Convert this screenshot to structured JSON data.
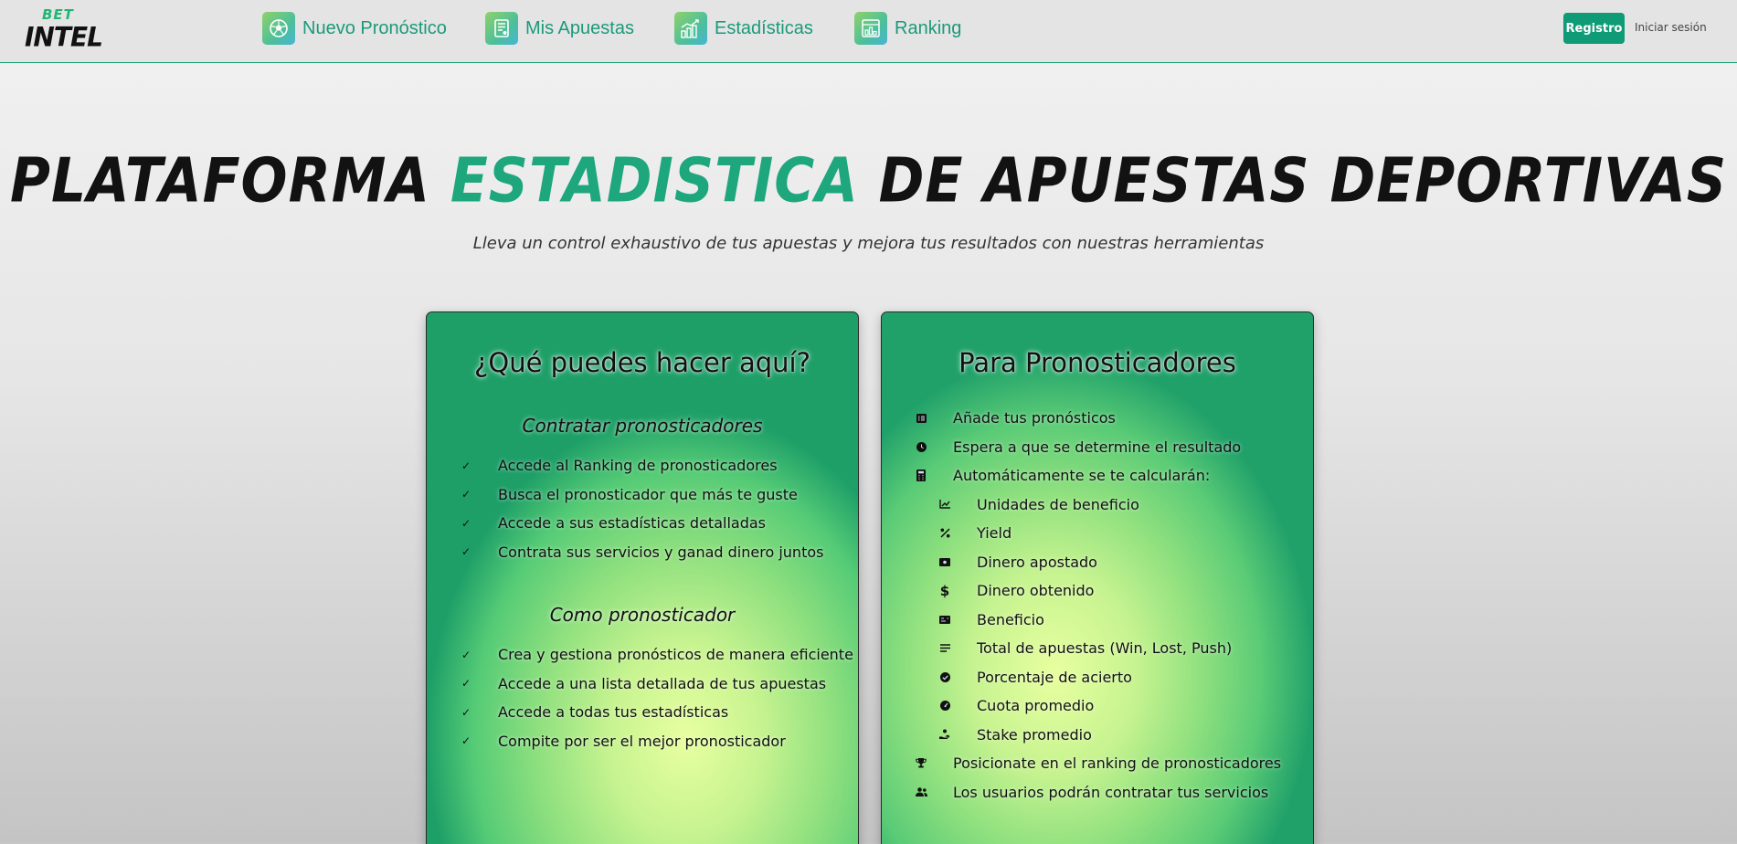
{
  "logo": {
    "line1": "BET",
    "line2": "INTEL"
  },
  "nav": [
    {
      "label": "Nuevo Pronóstico",
      "icon": "soccer-ball-icon"
    },
    {
      "label": "Mis Apuestas",
      "icon": "bet-slip-icon"
    },
    {
      "label": "Estadísticas",
      "icon": "bar-chart-icon"
    },
    {
      "label": "Ranking",
      "icon": "ranking-icon"
    }
  ],
  "auth": {
    "register": "Registro",
    "login": "Iniciar sesión"
  },
  "hero": {
    "title_part1": "PLATAFORMA ",
    "title_accent": "ESTADISTICA",
    "title_part2": " DE APUESTAS DEPORTIVAS",
    "subtitle": "Lleva un control exhaustivo de tus apuestas y mejora tus resultados con nuestras herramientas"
  },
  "left_card": {
    "title": "¿Qué puedes hacer aquí?",
    "section1": {
      "title": "Contratar pronosticadores",
      "items": [
        "Accede al Ranking de pronosticadores",
        "Busca el pronosticador que más te guste",
        "Accede a sus estadísticas detalladas",
        "Contrata sus servicios y ganad dinero juntos"
      ]
    },
    "section2": {
      "title": "Como pronosticador",
      "items": [
        "Crea y gestiona pronósticos de manera eficiente",
        "Accede a una lista detallada de tus apuestas",
        "Accede a todas tus estadísticas",
        "Compite por ser el mejor pronosticador"
      ]
    }
  },
  "right_card": {
    "title": "Para Pronosticadores",
    "items": [
      {
        "text": "Añade tus pronósticos",
        "icon": "list-icon"
      },
      {
        "text": "Espera a que se determine el resultado",
        "icon": "clock-icon"
      },
      {
        "text": "Automáticamente se te calcularán:",
        "icon": "calculator-icon"
      },
      {
        "text": "Unidades de beneficio",
        "icon": "line-chart-icon",
        "sub": true
      },
      {
        "text": "Yield",
        "icon": "percent-icon",
        "sub": true
      },
      {
        "text": "Dinero apostado",
        "icon": "money-bill-icon",
        "sub": true
      },
      {
        "text": "Dinero obtenido",
        "icon": "dollar-icon",
        "sub": true
      },
      {
        "text": "Beneficio",
        "icon": "money-check-icon",
        "sub": true
      },
      {
        "text": "Total de apuestas (Win, Lost, Push)",
        "icon": "bars-icon",
        "sub": true
      },
      {
        "text": "Porcentaje de acierto",
        "icon": "check-circle-icon",
        "sub": true
      },
      {
        "text": "Cuota promedio",
        "icon": "gauge-icon",
        "sub": true
      },
      {
        "text": "Stake promedio",
        "icon": "hand-holding-icon",
        "sub": true
      },
      {
        "text": "Posicionate en el ranking de pronosticadores",
        "icon": "trophy-icon"
      },
      {
        "text": "Los usuarios podrán contratar tus servicios",
        "icon": "users-icon"
      }
    ]
  }
}
